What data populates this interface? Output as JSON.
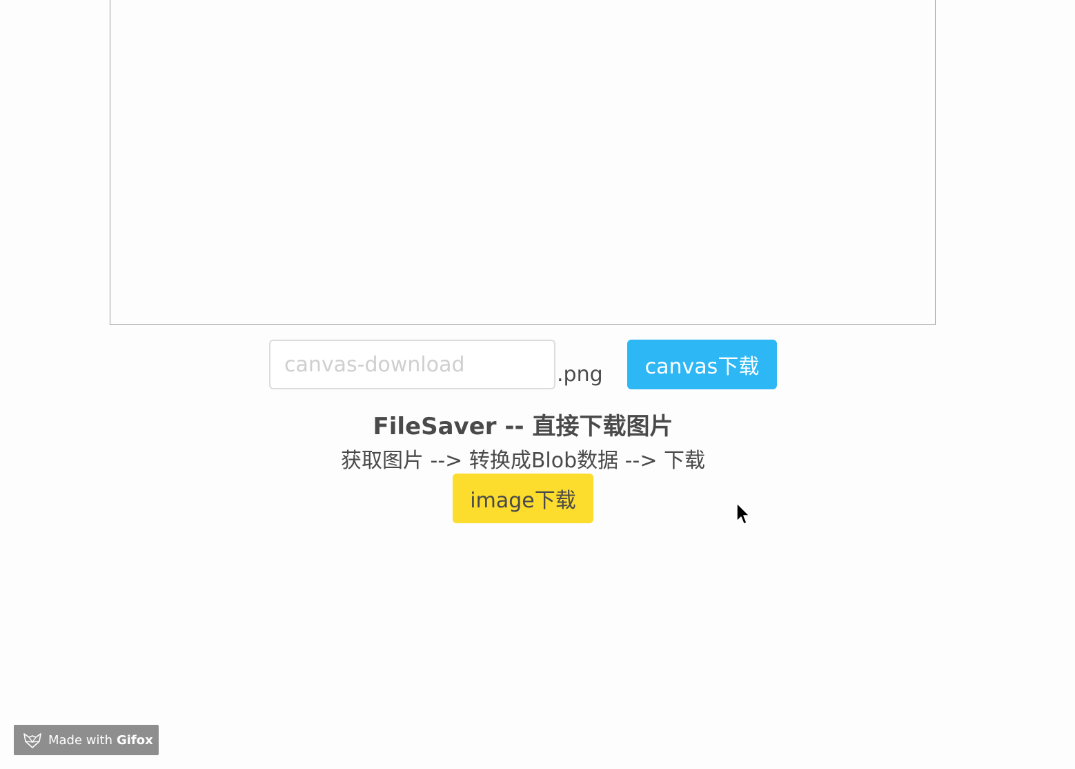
{
  "canvas_form": {
    "filename_placeholder": "canvas-download",
    "filename_value": "",
    "extension": ".png",
    "download_label": "canvas下载"
  },
  "filesaver": {
    "title": "FileSaver -- 直接下载图片",
    "flow": "获取图片 --> 转换成Blob数据 --> 下载",
    "download_label": "image下载"
  },
  "badge": {
    "prefix": "Made with",
    "brand": "Gifox",
    "icon": "fox-icon"
  },
  "colors": {
    "canvas_button": "#2db7f5",
    "image_button": "#fcdc2c"
  }
}
